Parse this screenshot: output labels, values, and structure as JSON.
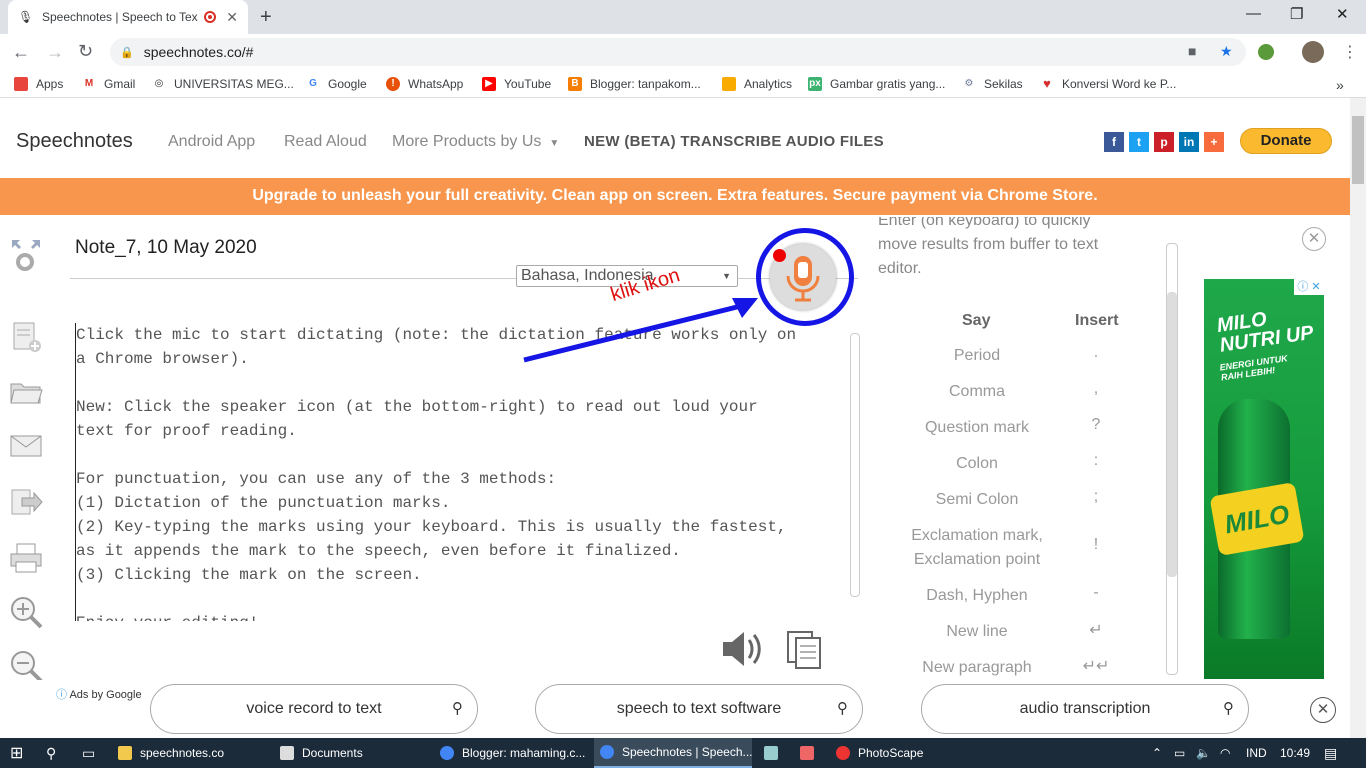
{
  "browser": {
    "tab_title": "Speechnotes | Speech to Tex",
    "url": "speechnotes.co/#",
    "bookmarks": [
      {
        "label": "Apps",
        "color": "#e8453c"
      },
      {
        "label": "Gmail",
        "color": "#d93025"
      },
      {
        "label": "UNIVERSITAS MEG...",
        "color": "#333333"
      },
      {
        "label": "Google",
        "color": "#4285f4"
      },
      {
        "label": "WhatsApp",
        "color": "#e8510a"
      },
      {
        "label": "YouTube",
        "color": "#ff0000"
      },
      {
        "label": "Blogger: tanpakom...",
        "color": "#f57d00"
      },
      {
        "label": "Analytics",
        "color": "#f9ab00"
      },
      {
        "label": "Gambar gratis yang...",
        "color": "#3cb371"
      },
      {
        "label": "Sekilas",
        "color": "#6a7a9a"
      },
      {
        "label": "Konversi Word ke P...",
        "color": "#d32f2f"
      }
    ]
  },
  "site": {
    "brand": "Speechnotes",
    "nav": [
      "Android App",
      "Read Aloud",
      "More Products by Us"
    ],
    "beta": "NEW (BETA) TRANSCRIBE AUDIO FILES",
    "donate": "Donate",
    "banner": "Upgrade to unleash your full creativity. Clean app on screen. Extra features. Secure payment via Chrome Store.",
    "colors": {
      "banner": "#f7964c",
      "donate": "#fbb930",
      "annotation": "#1515e6"
    }
  },
  "editor": {
    "note_title": "Note_7, 10 May 2020",
    "language": "Bahasa, Indonesia",
    "text": "Click the mic to start dictating (note: the dictation feature works only on\na Chrome browser).\n\nNew: Click the speaker icon (at the bottom-right) to read out loud your\ntext for proof reading.\n\nFor punctuation, you can use any of the 3 methods:\n(1) Dictation of the punctuation marks.\n(2) Key-typing the marks using your keyboard. This is usually the fastest,\nas it appends the mark to the speech, even before it finalized.\n(3) Clicking the mark on the screen.\n\nEnjoy your editing!",
    "annotation": "klik ikon"
  },
  "panel": {
    "intro": "Enter (on keyboard) to quickly move results from buffer to text editor.",
    "col_say": "Say",
    "col_insert": "Insert",
    "rows": [
      {
        "say": "Period",
        "insert": "."
      },
      {
        "say": "Comma",
        "insert": ","
      },
      {
        "say": "Question mark",
        "insert": "?"
      },
      {
        "say": "Colon",
        "insert": ":"
      },
      {
        "say": "Semi Colon",
        "insert": ";"
      },
      {
        "say": "Exclamation mark, Exclamation point",
        "insert": "!"
      },
      {
        "say": "Dash, Hyphen",
        "insert": "-"
      },
      {
        "say": "New line",
        "insert": "↵"
      },
      {
        "say": "New paragraph",
        "insert": "↵↵"
      }
    ]
  },
  "ad": {
    "headline": "MILO NUTRI UP",
    "sub": "ENERGI UNTUK RAIH LEBIH!",
    "brand": "MILO"
  },
  "bottom_ads": {
    "ads_by": "Ads by Google",
    "searches": [
      "voice record to text",
      "speech to text software",
      "audio transcription"
    ]
  },
  "taskbar": {
    "items": [
      "speechnotes.co",
      "Documents",
      "Blogger: mahaming.c...",
      "Speechnotes | Speech...",
      "PhotoScape"
    ],
    "lang": "IND",
    "time": "10:49"
  }
}
